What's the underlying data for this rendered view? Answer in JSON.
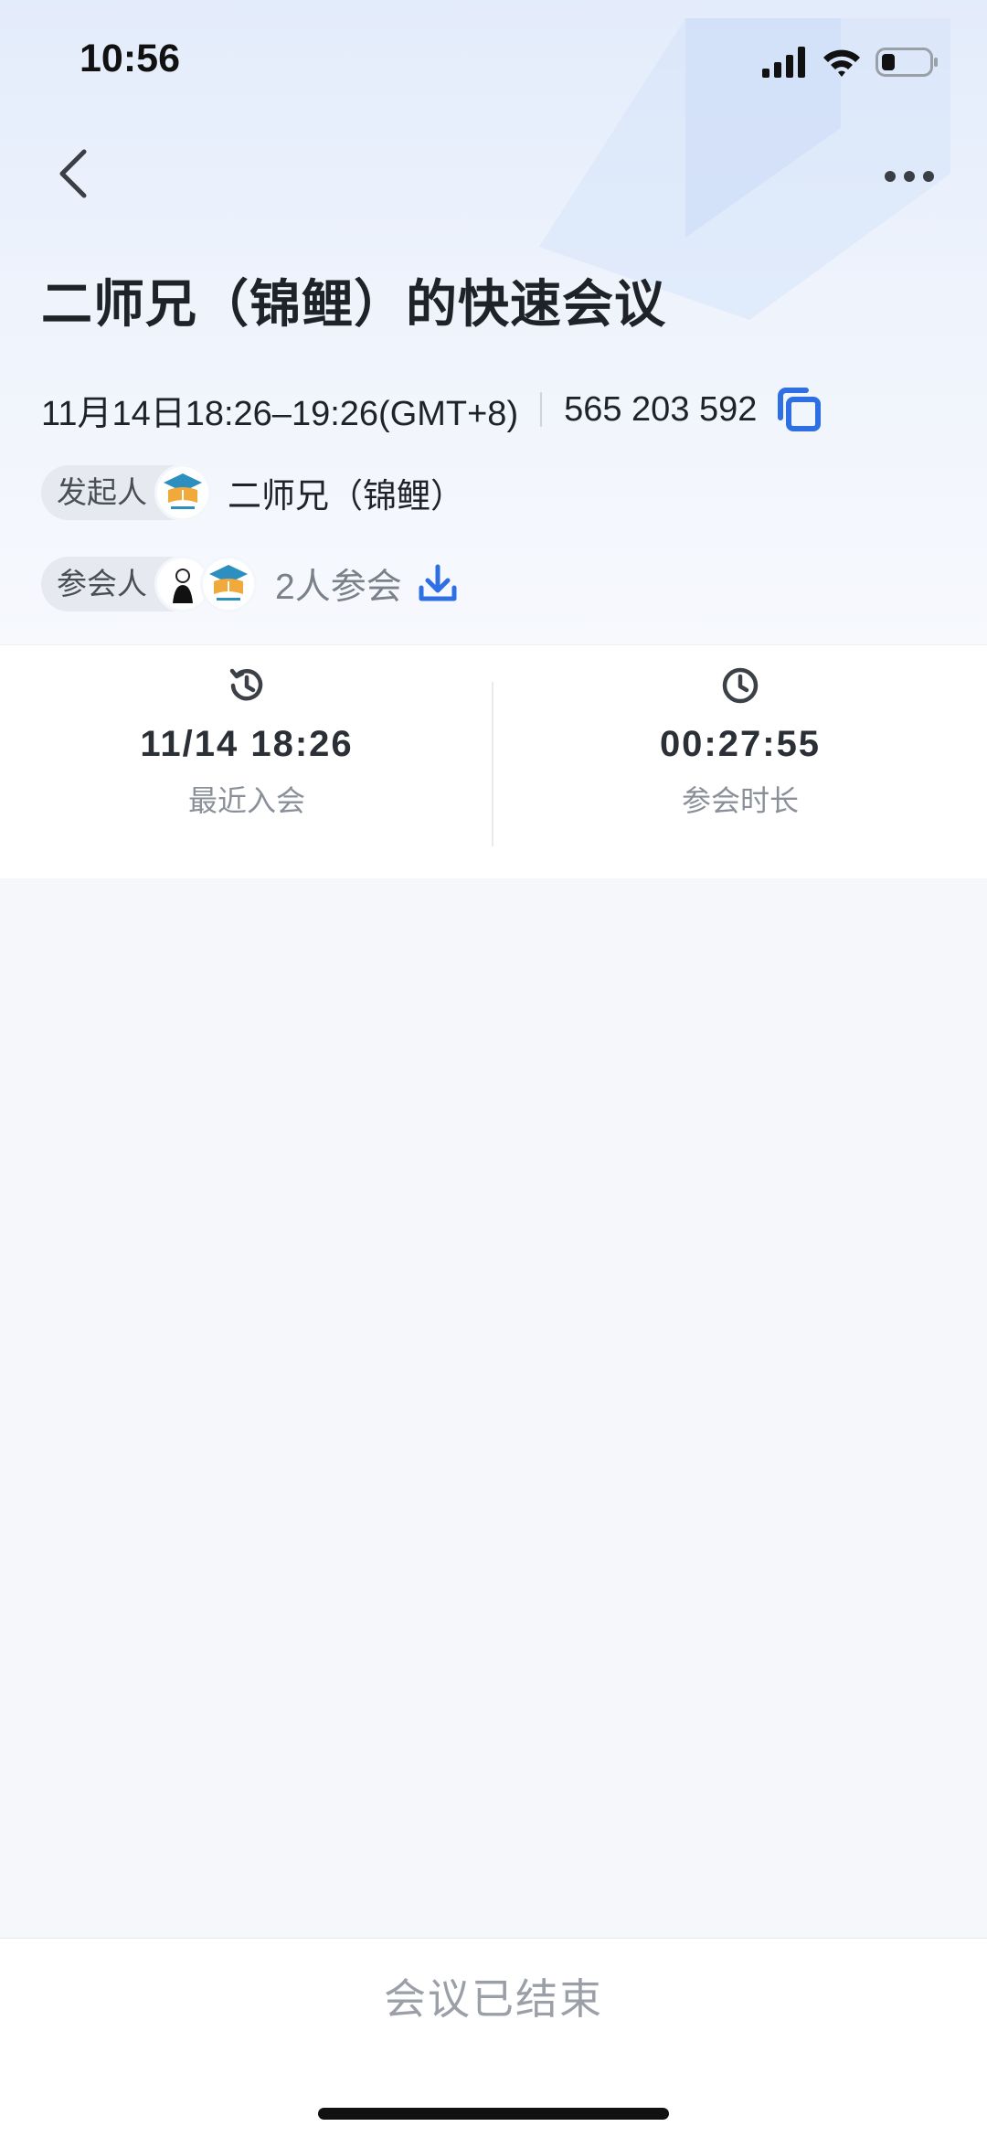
{
  "status_bar": {
    "time": "10:56"
  },
  "nav": {
    "back_icon": "chevron-left-icon",
    "more_icon": "more-horizontal-icon"
  },
  "meeting": {
    "title": "二师兄（锦鲤）的快速会议",
    "time_range": "11月14日18:26–19:26(GMT+8)",
    "meeting_id": "565 203 592",
    "host_label": "发起人",
    "host_name": "二师兄（锦鲤）",
    "attendees_label": "参会人",
    "attendee_count": "2人参会"
  },
  "stats": {
    "last_join": {
      "value": "11/14 18:26",
      "label": "最近入会"
    },
    "duration": {
      "value": "00:27:55",
      "label": "参会时长"
    }
  },
  "footer": {
    "status": "会议已结束"
  },
  "colors": {
    "accent": "#2f6fe4",
    "hero_bg": "#e3ecfb",
    "muted": "#9ba0a8"
  }
}
